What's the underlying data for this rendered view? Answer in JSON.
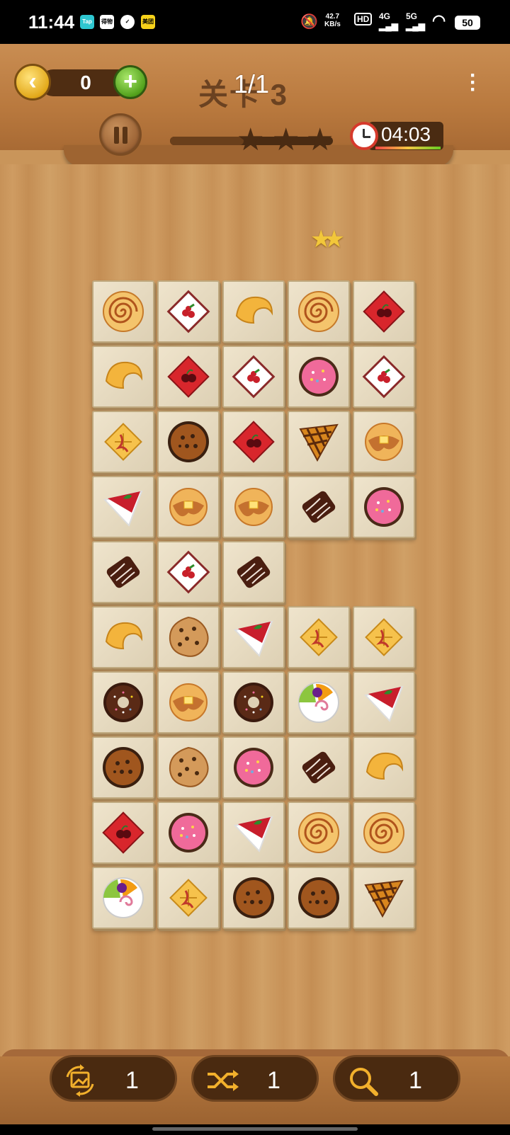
{
  "status_bar": {
    "time": "11:44",
    "app_icons": [
      "Tap",
      "得物",
      "✓",
      "美团"
    ],
    "network_speed_top": "42.7",
    "network_speed_bottom": "KB/s",
    "hd_label": "HD",
    "signal_4g": "4G",
    "signal_5g": "5G",
    "battery": "50"
  },
  "header": {
    "score": "0",
    "level_label": "关卡 3",
    "level_overlay": "1/1",
    "timer": "04:03",
    "progress_fraction": 0.45,
    "progress_stars": 3
  },
  "combo_stars": "★★",
  "board": {
    "tiles": [
      {
        "row": 0,
        "col": 0,
        "kind": "cinnamon-roll"
      },
      {
        "row": 0,
        "col": 1,
        "kind": "cherry-card-white"
      },
      {
        "row": 0,
        "col": 2,
        "kind": "fortune-cookie"
      },
      {
        "row": 0,
        "col": 3,
        "kind": "cinnamon-roll"
      },
      {
        "row": 0,
        "col": 4,
        "kind": "cherry-card-red"
      },
      {
        "row": 1,
        "col": 0,
        "kind": "fortune-cookie"
      },
      {
        "row": 1,
        "col": 1,
        "kind": "cherry-card-red"
      },
      {
        "row": 1,
        "col": 2,
        "kind": "cherry-card-white"
      },
      {
        "row": 1,
        "col": 3,
        "kind": "pink-cake"
      },
      {
        "row": 1,
        "col": 4,
        "kind": "cherry-card-white"
      },
      {
        "row": 2,
        "col": 0,
        "kind": "waffle"
      },
      {
        "row": 2,
        "col": 1,
        "kind": "choc-chip-muffin"
      },
      {
        "row": 2,
        "col": 2,
        "kind": "cherry-card-red"
      },
      {
        "row": 2,
        "col": 3,
        "kind": "lattice-pie"
      },
      {
        "row": 2,
        "col": 4,
        "kind": "pancake"
      },
      {
        "row": 3,
        "col": 0,
        "kind": "cheesecake-slice"
      },
      {
        "row": 3,
        "col": 1,
        "kind": "pancake"
      },
      {
        "row": 3,
        "col": 2,
        "kind": "pancake"
      },
      {
        "row": 3,
        "col": 3,
        "kind": "chocolate-bar"
      },
      {
        "row": 3,
        "col": 4,
        "kind": "pink-cake"
      },
      {
        "row": 4,
        "col": 0,
        "kind": "chocolate-bar"
      },
      {
        "row": 4,
        "col": 1,
        "kind": "cherry-card-white"
      },
      {
        "row": 4,
        "col": 2,
        "kind": "chocolate-bar"
      },
      {
        "row": 5,
        "col": 0,
        "kind": "fortune-cookie"
      },
      {
        "row": 5,
        "col": 1,
        "kind": "cookie"
      },
      {
        "row": 5,
        "col": 2,
        "kind": "cheesecake-slice"
      },
      {
        "row": 5,
        "col": 3,
        "kind": "waffle"
      },
      {
        "row": 5,
        "col": 4,
        "kind": "waffle"
      },
      {
        "row": 6,
        "col": 0,
        "kind": "donut"
      },
      {
        "row": 6,
        "col": 1,
        "kind": "pancake"
      },
      {
        "row": 6,
        "col": 2,
        "kind": "donut"
      },
      {
        "row": 6,
        "col": 3,
        "kind": "fruit-tart"
      },
      {
        "row": 6,
        "col": 4,
        "kind": "cheesecake-slice"
      },
      {
        "row": 7,
        "col": 0,
        "kind": "choc-chip-muffin"
      },
      {
        "row": 7,
        "col": 1,
        "kind": "cookie"
      },
      {
        "row": 7,
        "col": 2,
        "kind": "pink-cake"
      },
      {
        "row": 7,
        "col": 3,
        "kind": "chocolate-bar"
      },
      {
        "row": 7,
        "col": 4,
        "kind": "fortune-cookie"
      },
      {
        "row": 8,
        "col": 0,
        "kind": "cherry-card-red"
      },
      {
        "row": 8,
        "col": 1,
        "kind": "pink-cake"
      },
      {
        "row": 8,
        "col": 2,
        "kind": "cheesecake-slice"
      },
      {
        "row": 8,
        "col": 3,
        "kind": "cinnamon-roll"
      },
      {
        "row": 8,
        "col": 4,
        "kind": "cinnamon-roll"
      },
      {
        "row": 9,
        "col": 0,
        "kind": "fruit-tart"
      },
      {
        "row": 9,
        "col": 1,
        "kind": "waffle"
      },
      {
        "row": 9,
        "col": 2,
        "kind": "choc-chip-muffin"
      },
      {
        "row": 9,
        "col": 3,
        "kind": "choc-chip-muffin"
      },
      {
        "row": 9,
        "col": 4,
        "kind": "lattice-pie"
      }
    ]
  },
  "powerups": [
    {
      "name": "refresh-image-icon",
      "count": "1"
    },
    {
      "name": "shuffle-icon",
      "count": "1"
    },
    {
      "name": "search-icon",
      "count": "1"
    }
  ]
}
